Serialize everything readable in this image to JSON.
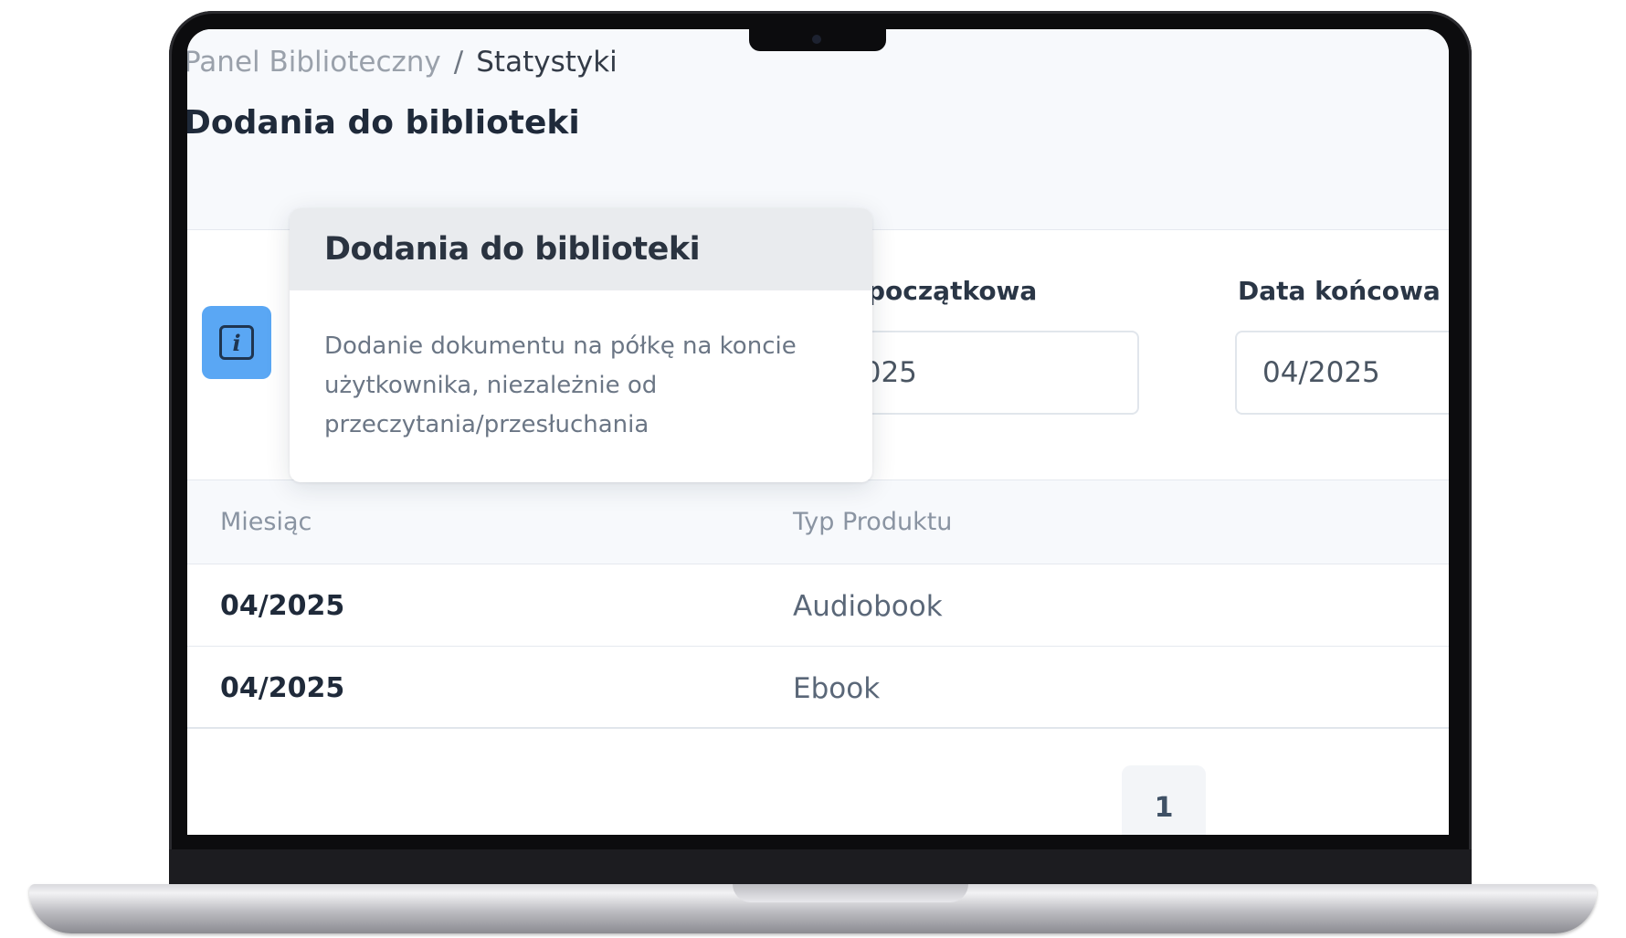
{
  "breadcrumb": {
    "root": "Panel Biblioteczny",
    "separator": "/",
    "current": "Statystyki"
  },
  "page": {
    "title": "Dodania do biblioteki"
  },
  "info_button": {
    "icon": "info-icon",
    "glyph": "i"
  },
  "tooltip": {
    "title": "Dodania do biblioteki",
    "body": "Dodanie dokumentu na półkę na koncie użytkownika, niezależnie od przeczytania/przesłuchania"
  },
  "filters": {
    "start_label": "początkowa",
    "start_value": "2025",
    "end_label": "Data końcowa",
    "end_value": "04/2025"
  },
  "table": {
    "columns": [
      "Miesiąc",
      "Typ Produktu"
    ],
    "rows": [
      {
        "month": "04/2025",
        "type": "Audiobook"
      },
      {
        "month": "04/2025",
        "type": "Ebook"
      }
    ]
  },
  "pagination": {
    "current_page": "1"
  },
  "colors": {
    "accent": "#5aa7f4",
    "title_text": "#1f2a3a",
    "muted_text": "#8a94a2"
  }
}
